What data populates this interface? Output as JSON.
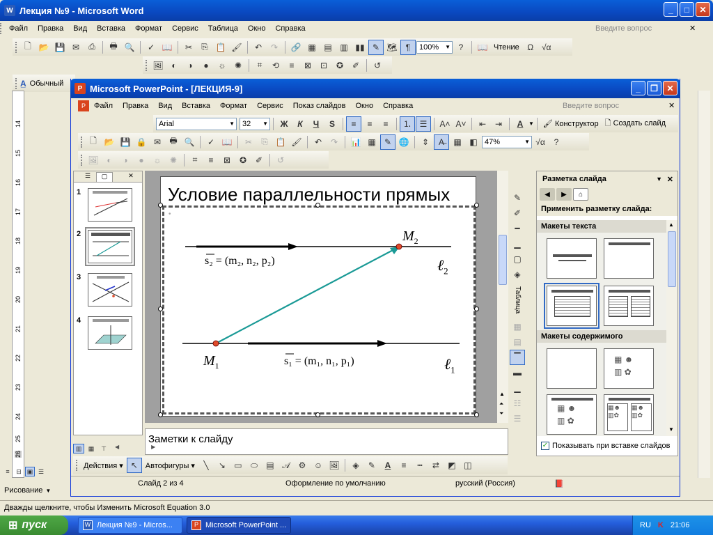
{
  "word": {
    "title": "Лекция №9 - Microsoft Word",
    "menu": [
      "Файл",
      "Правка",
      "Вид",
      "Вставка",
      "Формат",
      "Сервис",
      "Таблица",
      "Окно",
      "Справка"
    ],
    "ask_placeholder": "Введите вопрос",
    "zoom": "100%",
    "reading_label": "Чтение",
    "style_value": "Обычный",
    "ruler_numbers": [
      "14",
      "15",
      "16",
      "17",
      "18",
      "19",
      "20",
      "21",
      "22",
      "23",
      "24",
      "25",
      "26"
    ],
    "draw_label": "Рисование",
    "status_text": "Дважды щелкните, чтобы Изменить Microsoft Equation 3.0"
  },
  "ppt": {
    "title": "Microsoft PowerPoint - [ЛЕКЦИЯ-9]",
    "menu": [
      "Файл",
      "Правка",
      "Вид",
      "Вставка",
      "Формат",
      "Сервис",
      "Показ слайдов",
      "Окно",
      "Справка"
    ],
    "ask_placeholder": "Введите вопрос",
    "font_name": "Arial",
    "font_size": "32",
    "designer_label": "Конструктор",
    "new_slide_label": "Создать слайд",
    "zoom": "47%",
    "slide_numbers": [
      "1",
      "2",
      "3",
      "4"
    ],
    "notes_placeholder": "Заметки к слайду",
    "actions_label": "Действия",
    "autoshapes_label": "Автофигуры",
    "status": {
      "slide": "Слайд 2 из 4",
      "design": "Оформление по умолчанию",
      "language": "русский (Россия)"
    },
    "table_label": "Таблица"
  },
  "slide": {
    "title": "Условие параллельности прямых",
    "m2": "M",
    "m2_sub": "2",
    "m1": "M",
    "m1_sub": "1",
    "s2_eq": "s₂ = (m₂, n₂, p₂)",
    "s1_eq": "s₁ = (m₁, n₁, p₁)",
    "l2": "ℓ",
    "l2_sub": "2",
    "l1": "ℓ",
    "l1_sub": "1"
  },
  "task_pane": {
    "title": "Разметка слайда",
    "apply_label": "Применить разметку слайда:",
    "text_layouts": "Макеты текста",
    "content_layouts": "Макеты содержимого",
    "show_checkbox": "Показывать при вставке слайдов",
    "show_checked": true
  },
  "taskbar": {
    "start": "пуск",
    "items": [
      "Лекция №9 - Micros...",
      "Microsoft PowerPoint ..."
    ],
    "lang": "RU",
    "time": "21:06"
  },
  "colors": {
    "accent_teal": "#1a9a96",
    "point_red": "#e04b2a",
    "titlebar_blue": "#0a54d0"
  }
}
